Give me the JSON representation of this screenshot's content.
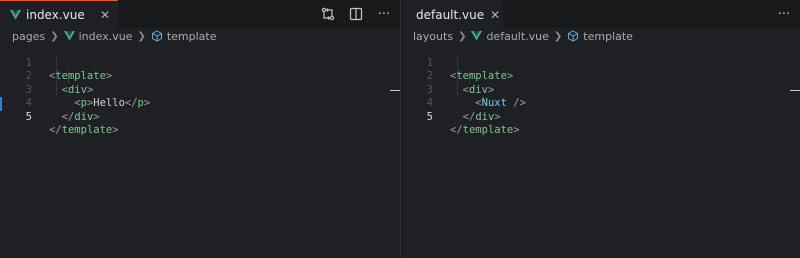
{
  "left": {
    "tab": {
      "icon": "vue-icon",
      "label": "index.vue",
      "close": "✕"
    },
    "actions": [
      {
        "icon": "compare-changes-icon",
        "glyph": "⇄"
      },
      {
        "icon": "split-editor-icon",
        "glyph": "◫"
      },
      {
        "icon": "more-actions-icon",
        "glyph": "···"
      }
    ],
    "breadcrumb": {
      "folder": "pages",
      "file": "index.vue",
      "symbol": "template"
    },
    "line_numbers": [
      "1",
      "2",
      "3",
      "4",
      "5"
    ],
    "active_line": "5",
    "code": [
      {
        "indent": "",
        "open": "<",
        "name": "template",
        "close": ">",
        "text": ""
      },
      {
        "indent": "  ",
        "open": "<",
        "name": "div",
        "close": ">",
        "text": ""
      },
      {
        "indent": "    ",
        "open": "<",
        "name": "p",
        "close": ">",
        "text": "Hello",
        "end_open": "</",
        "end_name": "p",
        "end_close": ">"
      },
      {
        "indent": "  ",
        "open": "</",
        "name": "div",
        "close": ">",
        "text": ""
      },
      {
        "indent": "",
        "open": "</",
        "name": "template",
        "close": ">",
        "text": ""
      }
    ]
  },
  "right": {
    "tab": {
      "icon": "vue-icon",
      "label": "default.vue",
      "close": "✕"
    },
    "actions": [
      {
        "icon": "more-actions-icon",
        "glyph": "···"
      }
    ],
    "breadcrumb": {
      "folder": "layouts",
      "file": "default.vue",
      "symbol": "template"
    },
    "line_numbers": [
      "1",
      "2",
      "3",
      "4",
      "5"
    ],
    "active_line": "5",
    "code": [
      {
        "indent": "",
        "open": "<",
        "name": "template",
        "close": ">"
      },
      {
        "indent": "  ",
        "open": "<",
        "name": "div",
        "close": ">"
      },
      {
        "indent": "    ",
        "open": "<",
        "name": "Nuxt",
        "close": " />"
      },
      {
        "indent": "  ",
        "open": "</",
        "name": "div",
        "close": ">"
      },
      {
        "indent": "",
        "open": "</",
        "name": "template",
        "close": ">"
      }
    ]
  },
  "colors": {
    "tag": "#7ec699",
    "component": "#7cc7f0",
    "vue_green": "#41b883",
    "vue_dark": "#35495e",
    "accent_top": "#e05a3a"
  }
}
